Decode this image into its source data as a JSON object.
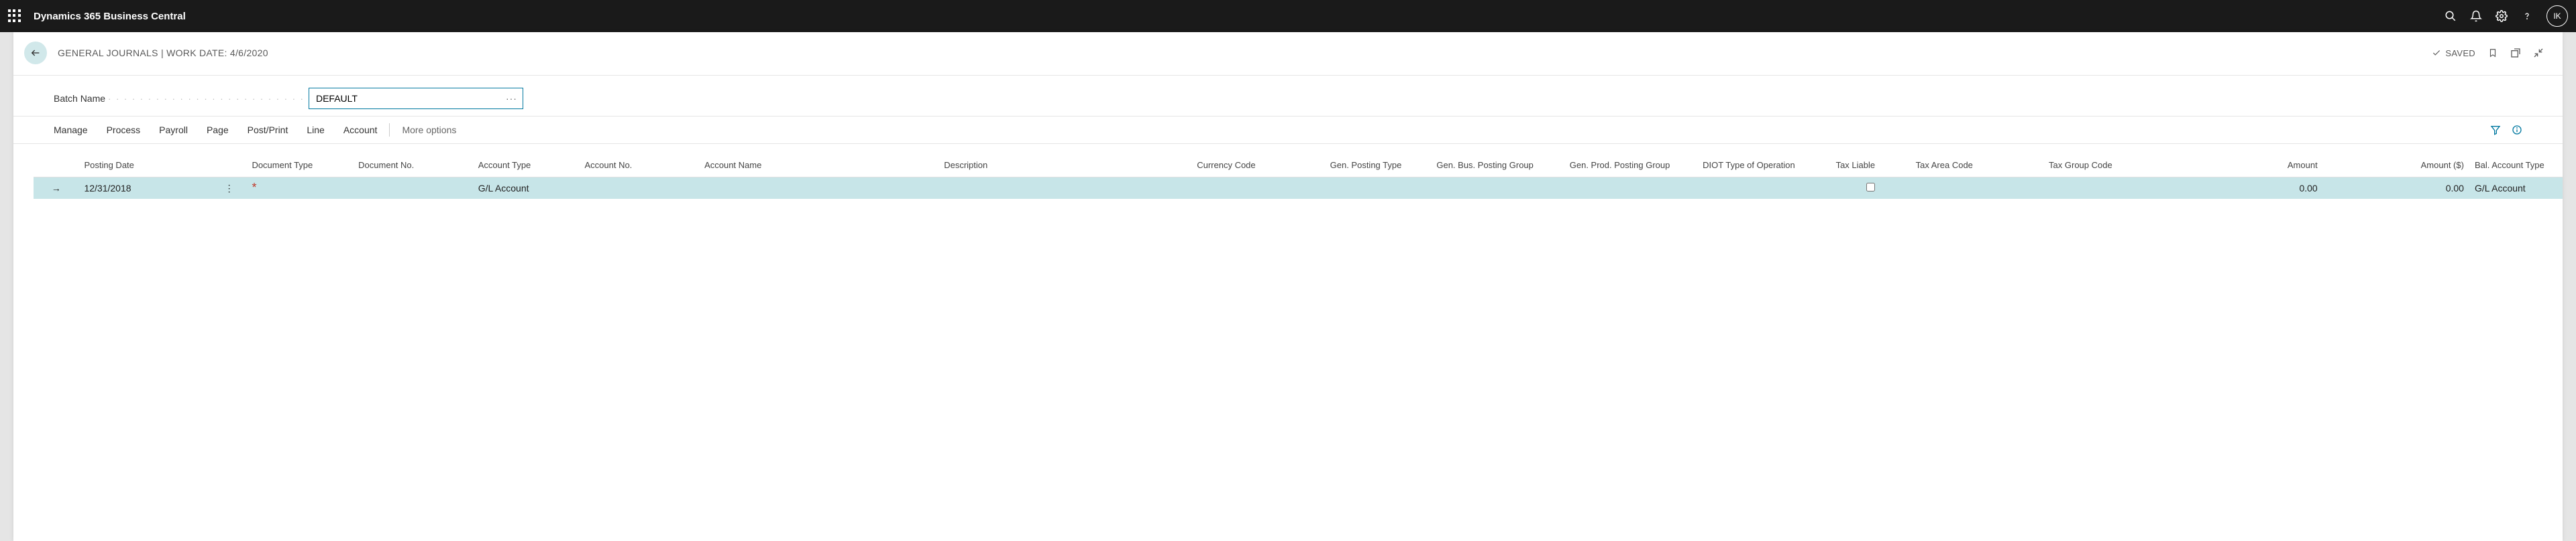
{
  "topbar": {
    "app_title": "Dynamics 365 Business Central",
    "user_initials": "IK"
  },
  "header": {
    "page_title": "GENERAL JOURNALS | WORK DATE: 4/6/2020",
    "saved_label": "SAVED"
  },
  "batch": {
    "label": "Batch Name",
    "value": "DEFAULT"
  },
  "toolbar": {
    "items": [
      "Manage",
      "Process",
      "Payroll",
      "Page",
      "Post/Print",
      "Line",
      "Account"
    ],
    "more_label": "More options"
  },
  "grid": {
    "headers": {
      "posting_date": "Posting Date",
      "doc_type": "Document Type",
      "doc_no": "Document No.",
      "acct_type": "Account Type",
      "acct_no": "Account No.",
      "acct_name": "Account Name",
      "description": "Description",
      "currency": "Currency Code",
      "gen_posting": "Gen. Posting Type",
      "gen_bus": "Gen. Bus. Posting Group",
      "gen_prod": "Gen. Prod. Posting Group",
      "diot": "DIOT Type of Operation",
      "tax_liable": "Tax Liable",
      "tax_area": "Tax Area Code",
      "tax_group": "Tax Group Code",
      "amount": "Amount",
      "amount_usd": "Amount ($)",
      "bal_acct": "Bal. Account Type"
    },
    "rows": [
      {
        "posting_date": "12/31/2018",
        "doc_type": "",
        "doc_no": "",
        "acct_type": "G/L Account",
        "acct_no": "",
        "acct_name": "",
        "description": "",
        "currency": "",
        "gen_posting": "",
        "gen_bus": "",
        "gen_prod": "",
        "diot": "",
        "tax_liable": false,
        "tax_area": "",
        "tax_group": "",
        "amount": "0.00",
        "amount_usd": "0.00",
        "bal_acct": "G/L Account"
      }
    ]
  }
}
